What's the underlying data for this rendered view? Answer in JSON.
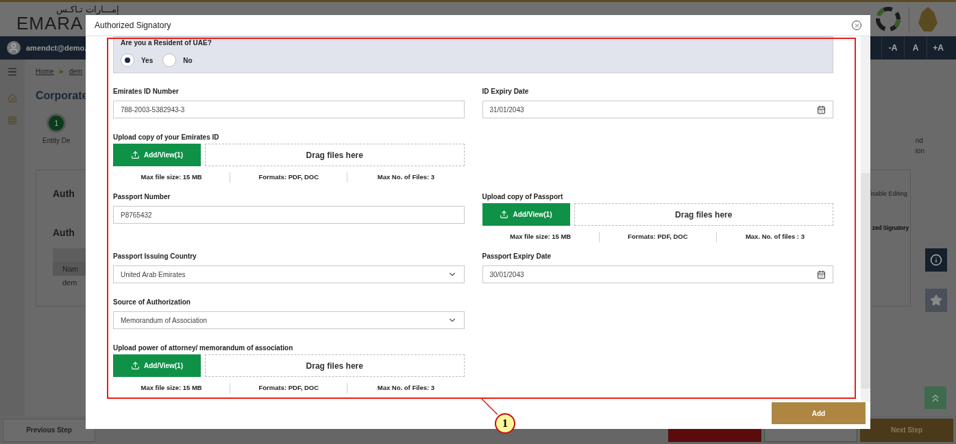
{
  "header": {
    "logo_arabic": "إمـــارات تـاكـس",
    "logo": "EMARA"
  },
  "user_bar": {
    "user": "amendct@demo.",
    "font_buttons": [
      "-A",
      "A",
      "+A"
    ]
  },
  "breadcrumb": [
    "Home",
    "dem"
  ],
  "breadcrumb_separator": "▶",
  "page": {
    "title": "Corporate",
    "step": {
      "number": "1",
      "label": "Entity De"
    },
    "step_right": [
      "nd",
      "ion"
    ],
    "section_titles": [
      "Auth",
      "Auth"
    ],
    "table_cells": [
      "Nam",
      "dem"
    ],
    "disable_editing": "isable Editing",
    "add_link": "zed Signatory"
  },
  "footer": {
    "previous": "Previous Step",
    "next": "Next Step"
  },
  "modal": {
    "title": "Authorized Signatory",
    "resident": {
      "label": "Are you a Resident of UAE?",
      "options": [
        {
          "label": "Yes",
          "selected": true
        },
        {
          "label": "No",
          "selected": false
        }
      ]
    },
    "rows": [
      {
        "left": {
          "kind": "text",
          "label": "Emirates ID Number",
          "value": "788-2003-5382943-3"
        },
        "right": {
          "kind": "date",
          "label": "ID Expiry Date",
          "value": "31/01/2043"
        }
      },
      {
        "left": {
          "kind": "upload",
          "label": "Upload copy of your Emirates ID",
          "button": "Add/View(1)",
          "drop": "Drag files here",
          "info": [
            "Max file size: 15 MB",
            "Formats: PDF, DOC",
            "Max No. of Files: 3"
          ]
        }
      },
      {
        "left": {
          "kind": "text",
          "label": "Passport Number",
          "value": "P8765432"
        },
        "right": {
          "kind": "upload",
          "label": "Upload copy of Passport",
          "button": "Add/View(1)",
          "drop": "Drag files here",
          "info": [
            "Max file size: 15 MB",
            "Formats: PDF, DOC",
            "Max. No. of files : 3"
          ]
        }
      },
      {
        "left": {
          "kind": "select",
          "label": "Passport Issuing Country",
          "value": "United Arab Emirates"
        },
        "right": {
          "kind": "date",
          "label": "Passport Expiry Date",
          "value": "30/01/2043"
        }
      },
      {
        "left": {
          "kind": "select",
          "label": "Source of Authorization",
          "value": "Memorandum of Association"
        }
      },
      {
        "left": {
          "kind": "upload",
          "label": "Upload power of attorney/ memorandum of association",
          "button": "Add/View(1)",
          "drop": "Drag files here",
          "info": [
            "Max file size: 15 MB",
            "Formats: PDF, DOC",
            "Max No. of Files: 3"
          ]
        }
      }
    ],
    "add_button": "Add"
  },
  "callout": "1"
}
